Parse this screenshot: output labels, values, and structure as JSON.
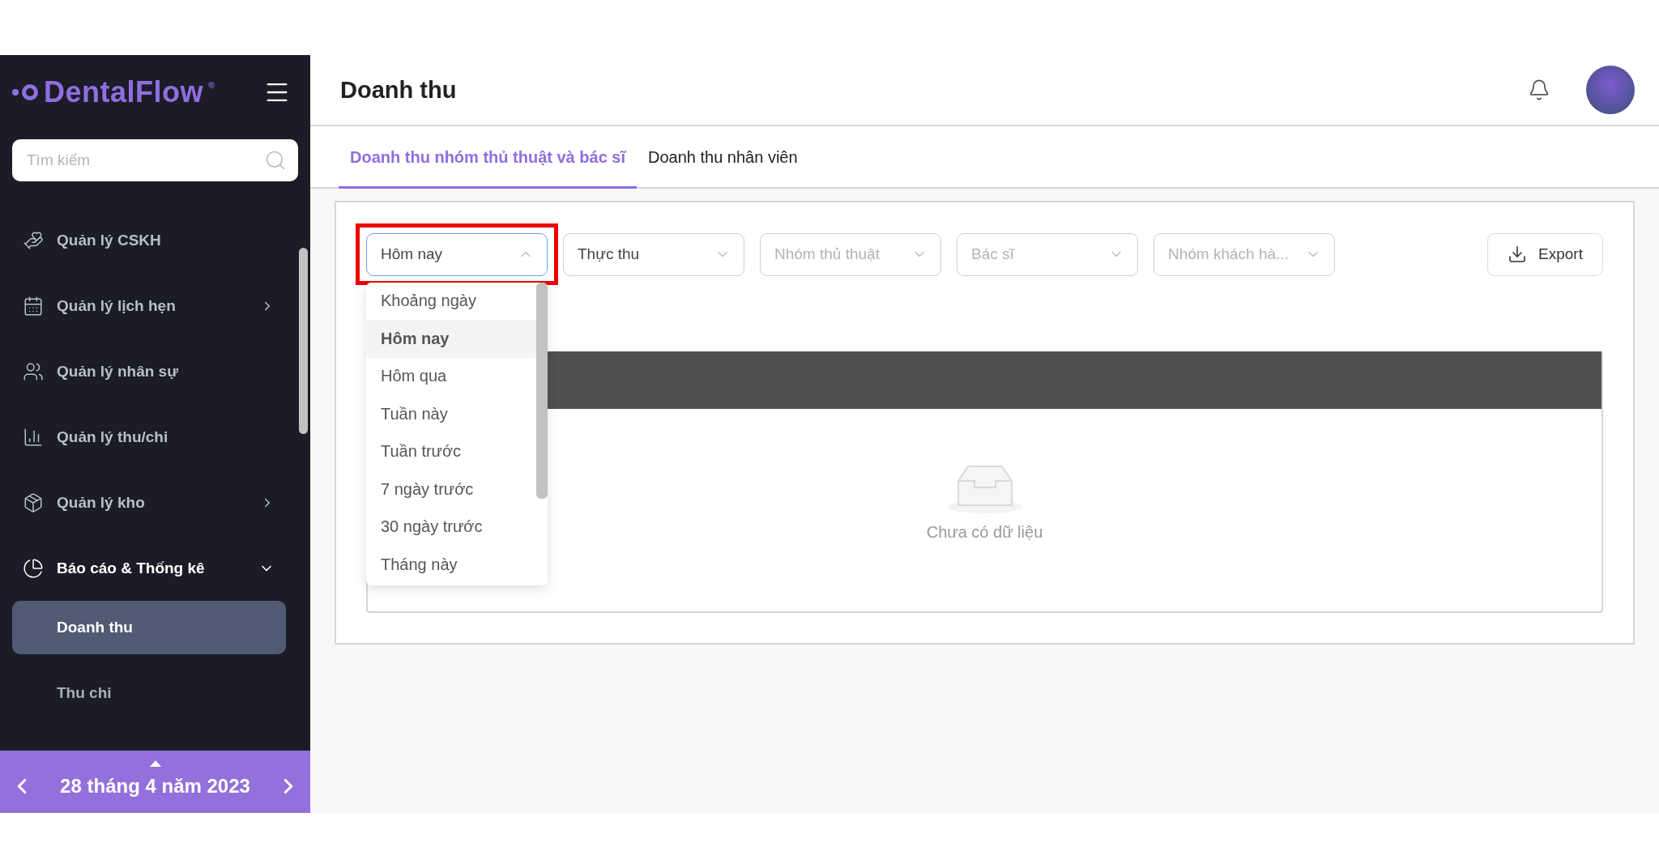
{
  "logo": {
    "name": "DentalFlow",
    "mark": "®"
  },
  "search": {
    "placeholder": "Tìm kiếm"
  },
  "sidebar": {
    "items": [
      {
        "label": "Quản lý CSKH",
        "kind": "link"
      },
      {
        "label": "Quản lý lịch hẹn",
        "kind": "group",
        "expanded": false
      },
      {
        "label": "Quản lý nhân sự",
        "kind": "link"
      },
      {
        "label": "Quản lý thu/chi",
        "kind": "link"
      },
      {
        "label": "Quản lý kho",
        "kind": "group",
        "expanded": false
      },
      {
        "label": "Báo cáo & Thống kê",
        "kind": "group",
        "expanded": true,
        "children": [
          {
            "label": "Doanh thu",
            "selected": true
          },
          {
            "label": "Thu chi",
            "selected": false
          }
        ]
      }
    ]
  },
  "date_bar": {
    "label": "28 tháng 4 năm 2023"
  },
  "header": {
    "title": "Doanh thu"
  },
  "tabs": [
    {
      "label": "Doanh thu nhóm thủ thuật và bác sĩ",
      "selected": true
    },
    {
      "label": "Doanh thu nhân viên",
      "selected": false
    }
  ],
  "filters": [
    {
      "value": "Hôm nay",
      "open": true,
      "highlighted": true,
      "options": [
        {
          "label": "Khoảng ngày",
          "selected": false
        },
        {
          "label": "Hôm nay",
          "selected": true
        },
        {
          "label": "Hôm qua",
          "selected": false
        },
        {
          "label": "Tuần này",
          "selected": false
        },
        {
          "label": "Tuần trước",
          "selected": false
        },
        {
          "label": "7 ngày trước",
          "selected": false
        },
        {
          "label": "30 ngày trước",
          "selected": false
        },
        {
          "label": "Tháng này",
          "selected": false
        }
      ]
    },
    {
      "value": "Thực thu",
      "open": false,
      "highlighted": false
    },
    {
      "placeholder": "Nhóm thủ thuật",
      "open": false,
      "highlighted": false
    },
    {
      "placeholder": "Bác sĩ",
      "open": false,
      "highlighted": false
    },
    {
      "placeholder": "Nhóm khách hà...",
      "open": false,
      "highlighted": false
    }
  ],
  "export_button": {
    "label": "Export"
  },
  "table": {
    "empty_text": "Chưa có dữ liệu"
  }
}
